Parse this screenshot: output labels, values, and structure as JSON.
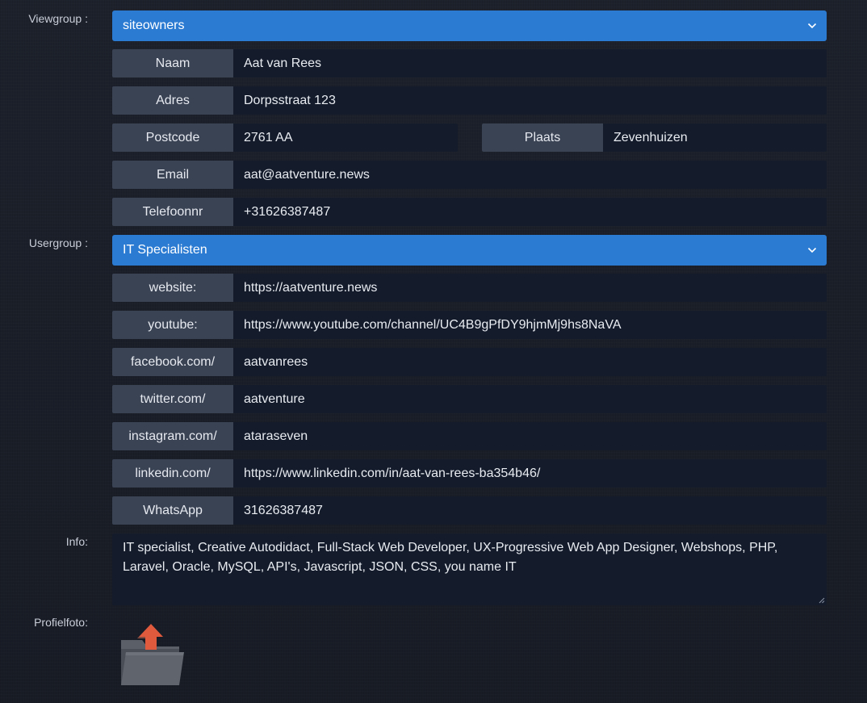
{
  "labels": {
    "viewgroup": "Viewgroup :",
    "usergroup": "Usergroup :",
    "info": "Info:",
    "profielfoto": "Profielfoto:"
  },
  "viewgroup_select": {
    "value": "siteowners",
    "icon": "chevron-down-icon"
  },
  "usergroup_select": {
    "value": "IT Specialisten",
    "icon": "chevron-down-icon"
  },
  "contact": {
    "naam": {
      "label": "Naam",
      "value": "Aat van Rees"
    },
    "adres": {
      "label": "Adres",
      "value": "Dorpsstraat 123"
    },
    "postcode": {
      "label": "Postcode",
      "value": "2761 AA"
    },
    "plaats": {
      "label": "Plaats",
      "value": "Zevenhuizen"
    },
    "email": {
      "label": "Email",
      "value": "aat@aatventure.news"
    },
    "telefoon": {
      "label": "Telefoonnr",
      "value": "+31626387487"
    }
  },
  "social": {
    "website": {
      "label": "website:",
      "value": "https://aatventure.news"
    },
    "youtube": {
      "label": "youtube:",
      "value": "https://www.youtube.com/channel/UC4B9gPfDY9hjmMj9hs8NaVA"
    },
    "facebook": {
      "label": "facebook.com/",
      "value": "aatvanrees"
    },
    "twitter": {
      "label": "twitter.com/",
      "value": "aatventure"
    },
    "instagram": {
      "label": "instagram.com/",
      "value": "ataraseven"
    },
    "linkedin": {
      "label": "linkedin.com/",
      "value": "https://www.linkedin.com/in/aat-van-rees-ba354b46/"
    },
    "whatsapp": {
      "label": "WhatsApp",
      "value": "31626387487"
    }
  },
  "info_text": "IT specialist, Creative Autodidact, Full-Stack Web Developer, UX-Progressive Web App Designer, Webshops, PHP, Laravel, Oracle, MySQL, API's, Javascript, JSON, CSS, you name IT",
  "upload": {
    "icon": "folder-upload-icon"
  },
  "colors": {
    "background": "#1a1f29",
    "select_accent": "#2b7bd3",
    "addon": "#3a4354",
    "field": "#141c2c",
    "upload_arrow": "#e05a3e"
  }
}
